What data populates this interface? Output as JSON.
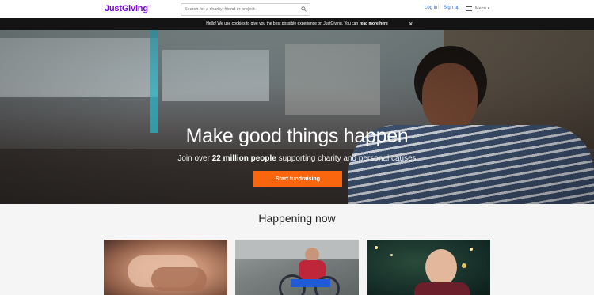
{
  "header": {
    "logo_text": "JustGiving",
    "logo_mark": "™",
    "search_placeholder": "Search for a charity, friend or project",
    "search_icon": "search-icon",
    "login_label": "Log in",
    "separator": "|",
    "signup_label": "Sign up",
    "menu_label": "Menu",
    "menu_icon": "hamburger-icon",
    "menu_caret": "▾"
  },
  "cookie_bar": {
    "text": "Hello! We use cookies to give you the best possible experience on JustGiving. You can ",
    "link_text": "read more here",
    "close_label": "×"
  },
  "hero": {
    "title": "Make good things happen",
    "subtitle_prefix": "Join over ",
    "subtitle_emphasis": "22 million people",
    "subtitle_suffix": " supporting charity and personal causes",
    "cta_label": "Start fundraising"
  },
  "happening": {
    "title": "Happening now",
    "cards": [
      {
        "image": "holding-hands-photo"
      },
      {
        "image": "handcycle-rider-photo"
      },
      {
        "image": "child-with-christmas-lights-photo"
      }
    ]
  },
  "colors": {
    "brand": "#7a04dd",
    "link": "#2a6ad8",
    "cta": "#f9660e",
    "cookie_bg": "#141414"
  }
}
